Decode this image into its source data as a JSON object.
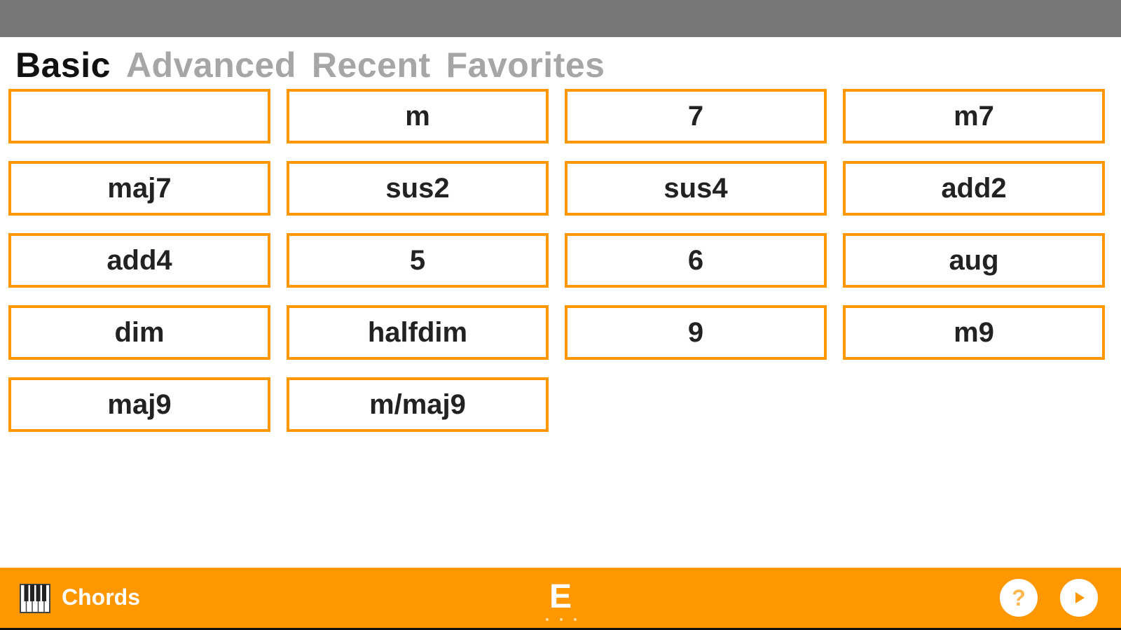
{
  "tabs": [
    {
      "label": "Basic",
      "active": true
    },
    {
      "label": "Advanced",
      "active": false
    },
    {
      "label": "Recent",
      "active": false
    },
    {
      "label": "Favorites",
      "active": false
    }
  ],
  "chords": [
    "",
    "m",
    "7",
    "m7",
    "maj7",
    "sus2",
    "sus4",
    "add2",
    "add4",
    "5",
    "6",
    "aug",
    "dim",
    "halfdim",
    "9",
    "m9",
    "maj9",
    "m/maj9"
  ],
  "bottom_bar": {
    "app_label": "Chords",
    "key": "E",
    "icons": {
      "app": "piano-icon",
      "help": "help-icon",
      "play": "play-icon"
    }
  },
  "colors": {
    "accent": "#ff9800",
    "status_bar": "#777777",
    "active_tab": "#111111",
    "inactive_tab": "#a6a6a6"
  }
}
